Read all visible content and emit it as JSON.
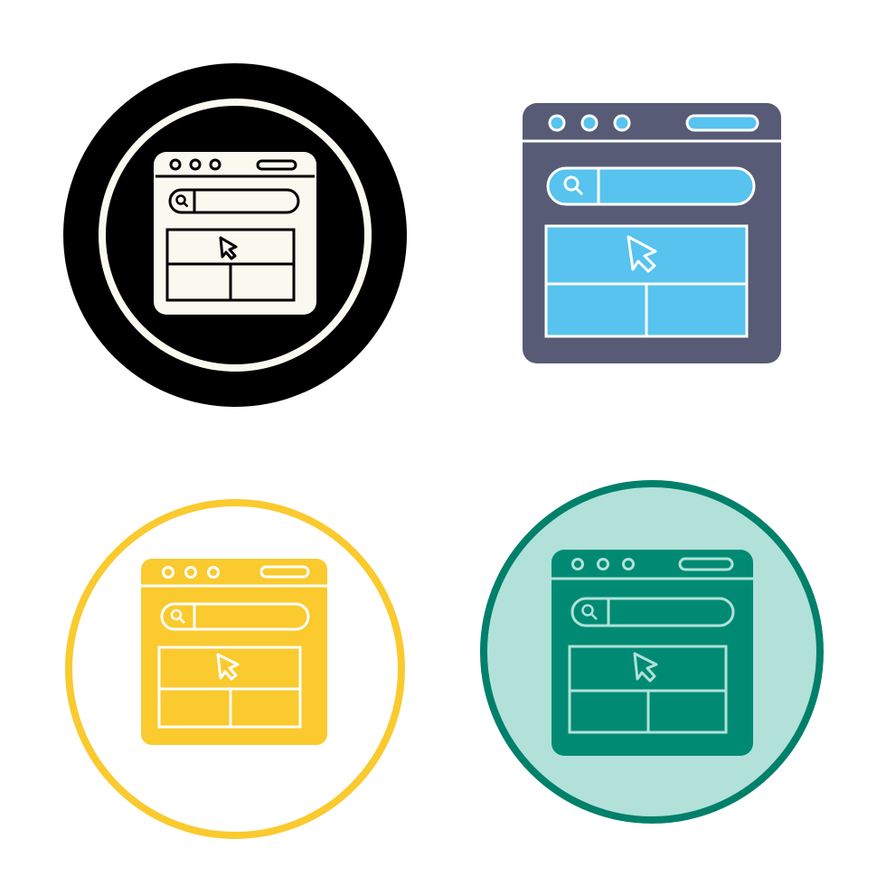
{
  "icons": [
    {
      "name": "web-browser-icon",
      "style": "glyph",
      "colors": {
        "background": "#000000",
        "ring": "#FAF9F0",
        "window": "#FAF9F0",
        "detail": "#000000"
      }
    },
    {
      "name": "web-browser-icon",
      "style": "flat",
      "colors": {
        "window": "#575B75",
        "accent": "#57C3EE",
        "detail": "#FFFFFF"
      }
    },
    {
      "name": "web-browser-icon",
      "style": "outline-circle",
      "colors": {
        "ring": "#FACA2E",
        "window": "#FACA2E",
        "detail": "#FFFFFF"
      }
    },
    {
      "name": "web-browser-icon",
      "style": "filled-circle",
      "colors": {
        "ring": "#00806A",
        "background": "#B1E1D9",
        "window": "#008A74",
        "detail": "#B1E1D9"
      }
    }
  ]
}
